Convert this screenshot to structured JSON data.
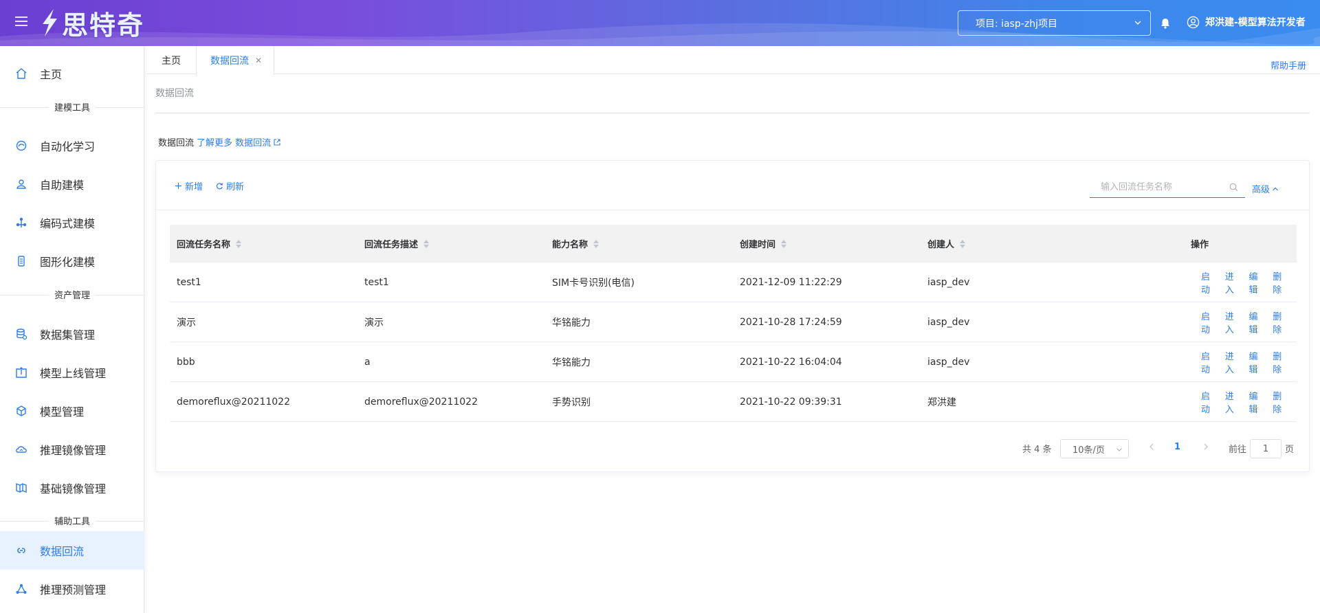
{
  "header": {
    "logo_text": "思特奇",
    "project_label": "项目: iasp-zhj项目",
    "user_label": "郑洪建-模型算法开发者"
  },
  "sidebar": {
    "items": [
      {
        "label": "主页",
        "icon": "home-icon"
      },
      {
        "label": "自动化学习",
        "icon": "auto-learn-icon"
      },
      {
        "label": "自助建模",
        "icon": "self-model-icon"
      },
      {
        "label": "编码式建模",
        "icon": "code-model-icon"
      },
      {
        "label": "图形化建模",
        "icon": "graphic-model-icon"
      },
      {
        "label": "数据集管理",
        "icon": "dataset-icon"
      },
      {
        "label": "模型上线管理",
        "icon": "model-deploy-icon"
      },
      {
        "label": "模型管理",
        "icon": "model-cube-icon"
      },
      {
        "label": "推理镜像管理",
        "icon": "inference-image-icon"
      },
      {
        "label": "基础镜像管理",
        "icon": "base-image-icon"
      },
      {
        "label": "数据回流",
        "icon": "data-reflux-icon"
      },
      {
        "label": "推理预测管理",
        "icon": "predict-icon"
      }
    ],
    "sections": [
      "建模工具",
      "资产管理",
      "辅助工具"
    ]
  },
  "tabs": [
    {
      "label": "主页"
    },
    {
      "label": "数据回流"
    }
  ],
  "help_label": "帮助手册",
  "breadcrumb": "数据回流",
  "intro": {
    "prefix": "数据回流",
    "link": "了解更多 数据回流"
  },
  "toolbar": {
    "add_label": "新增",
    "refresh_label": "刷新",
    "search_placeholder": "输入回流任务名称",
    "advanced_label": "高级"
  },
  "table": {
    "columns": [
      "回流任务名称",
      "回流任务描述",
      "能力名称",
      "创建时间",
      "创建人",
      "操作"
    ],
    "rows": [
      {
        "name": "test1",
        "desc": "test1",
        "ability": "SIM卡号识别(电信)",
        "time": "2021-12-09 11:22:29",
        "creator": "iasp_dev"
      },
      {
        "name": "演示",
        "desc": "演示",
        "ability": "华铭能力",
        "time": "2021-10-28 17:24:59",
        "creator": "iasp_dev"
      },
      {
        "name": "bbb",
        "desc": "a",
        "ability": "华铭能力",
        "time": "2021-10-22 16:04:04",
        "creator": "iasp_dev"
      },
      {
        "name": "demoreflux@20211022",
        "desc": "demoreflux@20211022",
        "ability": "手势识别",
        "time": "2021-10-22 09:39:31",
        "creator": "郑洪建"
      }
    ],
    "actions": [
      "启动",
      "进入",
      "编辑",
      "删除"
    ]
  },
  "pagination": {
    "total": "共 4 条",
    "page_size": "10条/页",
    "current": "1",
    "goto_label": "前往",
    "goto_value": "1",
    "page_unit": "页"
  },
  "colors": {
    "accent": "#2d7ee8",
    "header_start": "#6a3fd1",
    "header_end": "#3a8cf0",
    "active_bg": "#e8f1fe"
  }
}
